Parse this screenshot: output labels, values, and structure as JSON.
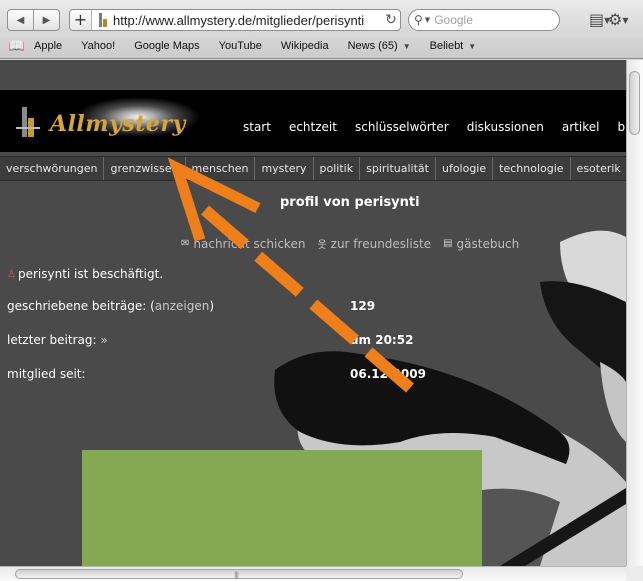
{
  "browser": {
    "back_label": "◀",
    "forward_label": "▶",
    "add_label": "+",
    "url": "http://www.allmystery.de/mitglieder/perisynti",
    "reload_label": "↻",
    "search_placeholder": "Google"
  },
  "bookmarks": [
    "Apple",
    "Yahoo!",
    "Google Maps",
    "YouTube",
    "Wikipedia",
    "News (65)",
    "Beliebt"
  ],
  "site": {
    "logo_text": "Allmystery",
    "main_nav": [
      "start",
      "echtzeit",
      "schlüsselwörter",
      "diskussionen",
      "artikel",
      "blog"
    ],
    "sub_nav": [
      "verschwörungen",
      "grenzwissen",
      "menschen",
      "mystery",
      "politik",
      "spiritualität",
      "ufologie",
      "technologie",
      "esoterik"
    ]
  },
  "profile": {
    "title": "profil von perisynti",
    "actions": [
      {
        "icon": "envelope-icon",
        "glyph": "✉",
        "label": "nachricht schicken"
      },
      {
        "icon": "person-icon",
        "glyph": "웃",
        "label": "zur freundesliste"
      },
      {
        "icon": "guestbook-icon",
        "glyph": "▤",
        "label": "gästebuch"
      }
    ],
    "status": "perisynti ist beschäftigt.",
    "posts_label_pre": "geschriebene beiträge: (",
    "posts_link": "anzeigen",
    "posts_label_post": ")",
    "posts_value": "129",
    "last_post_label": "letzter beitrag:",
    "last_post_value": "um 20:52",
    "member_since_label": "mitglied seit:",
    "member_since_value": "06.12.2009"
  },
  "colors": {
    "arrow": "#ef7f1a",
    "ad_box": "#84a952"
  }
}
